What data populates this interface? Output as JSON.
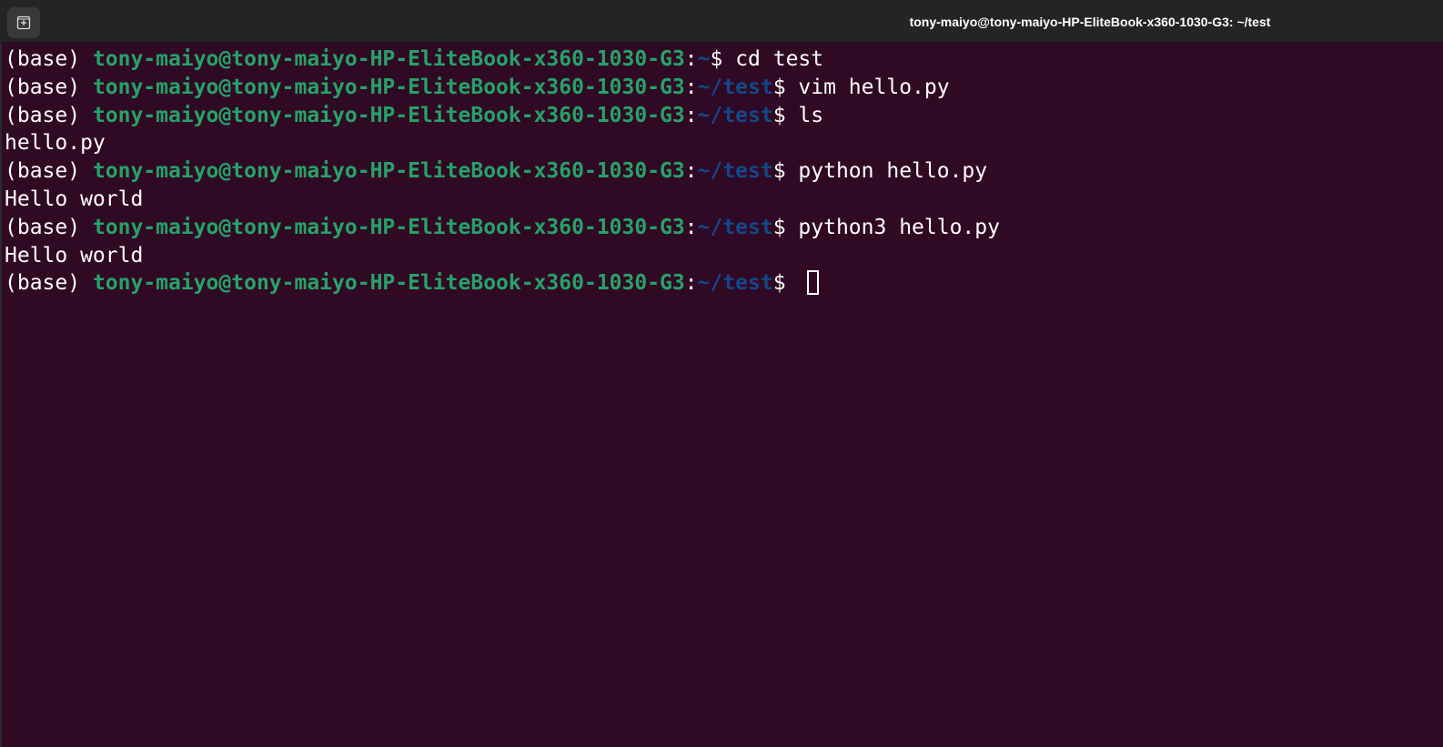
{
  "window": {
    "title": "tony-maiyo@tony-maiyo-HP-EliteBook-x360-1030-G3: ~/test",
    "new_tab_icon": "new-tab-icon"
  },
  "colors": {
    "background": "#300a24",
    "user_host": "#26a269",
    "path": "#12488b",
    "text": "#ffffff"
  },
  "terminal": {
    "lines": [
      {
        "type": "prompt",
        "env": "(base) ",
        "user_host": "tony-maiyo@tony-maiyo-HP-EliteBook-x360-1030-G3",
        "sep": ":",
        "path": "~",
        "symbol": "$ ",
        "command": "cd test"
      },
      {
        "type": "prompt",
        "env": "(base) ",
        "user_host": "tony-maiyo@tony-maiyo-HP-EliteBook-x360-1030-G3",
        "sep": ":",
        "path": "~/test",
        "symbol": "$ ",
        "command": "vim hello.py"
      },
      {
        "type": "prompt",
        "env": "(base) ",
        "user_host": "tony-maiyo@tony-maiyo-HP-EliteBook-x360-1030-G3",
        "sep": ":",
        "path": "~/test",
        "symbol": "$ ",
        "command": "ls"
      },
      {
        "type": "output",
        "text": "hello.py"
      },
      {
        "type": "prompt",
        "env": "(base) ",
        "user_host": "tony-maiyo@tony-maiyo-HP-EliteBook-x360-1030-G3",
        "sep": ":",
        "path": "~/test",
        "symbol": "$ ",
        "command": "python hello.py"
      },
      {
        "type": "output",
        "text": "Hello world"
      },
      {
        "type": "prompt",
        "env": "(base) ",
        "user_host": "tony-maiyo@tony-maiyo-HP-EliteBook-x360-1030-G3",
        "sep": ":",
        "path": "~/test",
        "symbol": "$ ",
        "command": "python3 hello.py"
      },
      {
        "type": "output",
        "text": "Hello world"
      },
      {
        "type": "prompt",
        "env": "(base) ",
        "user_host": "tony-maiyo@tony-maiyo-HP-EliteBook-x360-1030-G3",
        "sep": ":",
        "path": "~/test",
        "symbol": "$ ",
        "command": "",
        "cursor": true
      }
    ]
  }
}
